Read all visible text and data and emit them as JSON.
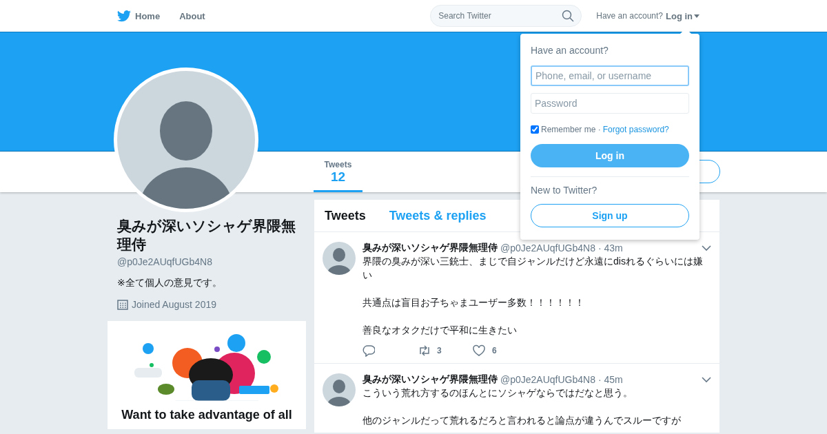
{
  "nav": {
    "items": [
      {
        "label": "Home",
        "kind": "home"
      },
      {
        "label": "About",
        "kind": "plain"
      }
    ],
    "search": {
      "placeholder": "Search Twitter"
    },
    "account_prompt": "Have an account?",
    "login_link": "Log in"
  },
  "profile_nav": {
    "tabs": [
      {
        "label": "Tweets",
        "count": "12",
        "selected": true
      }
    ]
  },
  "profile": {
    "name": "臭みが深いソシャゲ界隈無理侍",
    "handle": "@p0Je2AUqfUGb4N8",
    "bio": "※全て個人の意見です。",
    "joined": "Joined August 2019"
  },
  "promo": {
    "headline": "Want to take advantage of all"
  },
  "timeline": {
    "tabs": [
      {
        "label": "Tweets",
        "selected": true
      },
      {
        "label": "Tweets & replies",
        "selected": false
      }
    ],
    "tweets": [
      {
        "name": "臭みが深いソシャゲ界隈無理侍",
        "handle": "@p0Je2AUqfUGb4N8",
        "time": "· 43m",
        "paragraphs": [
          "界隈の臭みが深い三銃士、まじで自ジャンルだけど永遠にdisれるぐらいには嫌い",
          "共通点は盲目お子ちゃまユーザー多数！！！！！！",
          "善良なオタクだけで平和に生きたい"
        ],
        "actions": [
          {
            "kind": "reply"
          },
          {
            "kind": "retweet",
            "count": "3"
          },
          {
            "kind": "like",
            "count": "6"
          }
        ]
      },
      {
        "name": "臭みが深いソシャゲ界隈無理侍",
        "handle": "@p0Je2AUqfUGb4N8",
        "time": "· 45m",
        "paragraphs": [
          "こういう荒れ方するのほんとにソシャゲならではだなと思う。",
          "他のジャンルだって荒れるだろと言われると論点が違うんでスルーですが"
        ]
      }
    ]
  },
  "login_dropdown": {
    "title": "Have an account?",
    "fields": [
      {
        "placeholder": "Phone, email, or username",
        "focused": true
      },
      {
        "placeholder": "Password",
        "focused": false
      }
    ],
    "remember": {
      "label": "Remember me ·",
      "checked": true
    },
    "forgot_link": "Forgot password?",
    "login_button": "Log in",
    "signup_prompt": "New to Twitter?",
    "signup_button": "Sign up"
  }
}
